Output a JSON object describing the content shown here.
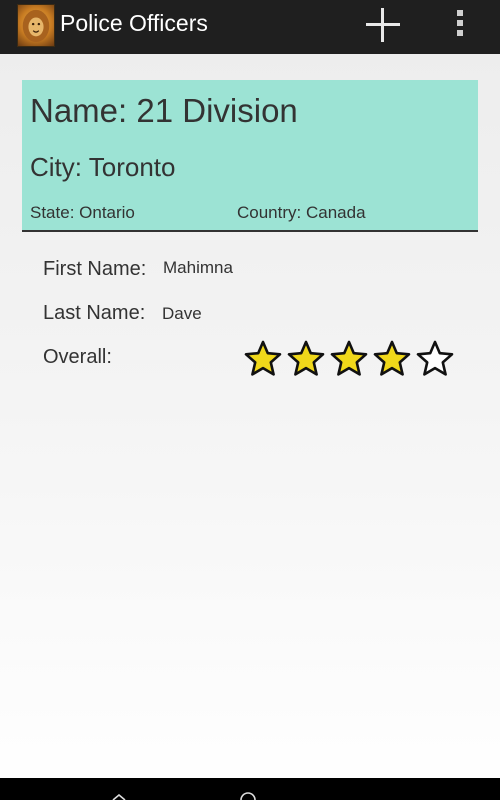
{
  "app": {
    "title": "Police Officers",
    "icon": "lion-logo-icon"
  },
  "toolbar": {
    "add_icon": "plus-icon",
    "overflow_icon": "overflow-menu-icon"
  },
  "division": {
    "name": "Name: 21 Division",
    "city": "City: Toronto",
    "state": "State: Ontario",
    "country": "Country: Canada",
    "background_color": "#9ce3d4"
  },
  "officer": {
    "first_name_label": "First Name:",
    "first_name": "Mahimna",
    "last_name_label": "Last Name:",
    "last_name": "Dave",
    "overall_label": "Overall:",
    "rating": 4,
    "rating_max": 5,
    "star_color": "#f0d81a"
  },
  "nav": {
    "back_icon": "back-icon",
    "home_icon": "home-icon"
  }
}
